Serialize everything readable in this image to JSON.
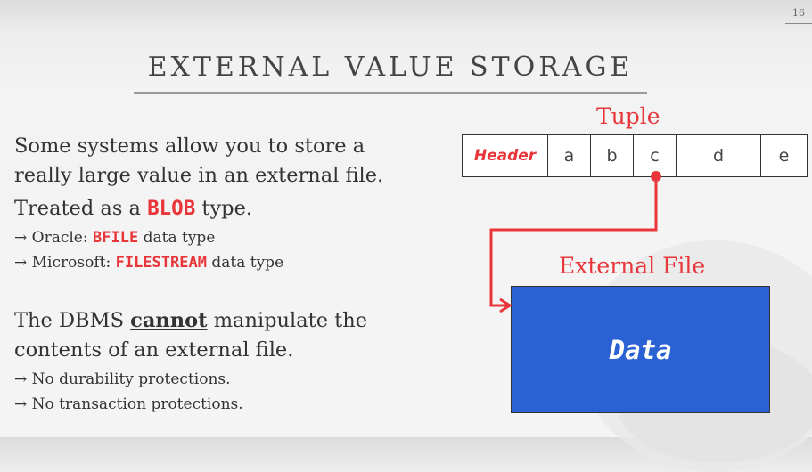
{
  "page_number": "16",
  "title": "EXTERNAL VALUE STORAGE",
  "para1": {
    "line1": "Some systems allow you to store a",
    "line2": "really large value in an external file.",
    "line3_pre": "Treated as a ",
    "line3_code": "BLOB",
    "line3_post": " type.",
    "bullets": [
      {
        "arrow": "→",
        "pre": " Oracle: ",
        "code": "BFILE",
        "post": " data type"
      },
      {
        "arrow": "→",
        "pre": " Microsoft: ",
        "code": "FILESTREAM",
        "post": " data type"
      }
    ]
  },
  "para2": {
    "line1_pre": "The DBMS ",
    "line1_u": "cannot",
    "line1_post": " manipulate the",
    "line2": "contents of an external file.",
    "bullets": [
      "→ No durability protections.",
      "→ No transaction protections."
    ]
  },
  "diagram": {
    "tuple_label": "Tuple",
    "tuple_cells": [
      "Header",
      "a",
      "b",
      "c",
      "d",
      "e"
    ],
    "external_file_label": "External File",
    "file_content": "Data",
    "arrow_color": "#e8363b",
    "file_color": "#2a62d4"
  }
}
